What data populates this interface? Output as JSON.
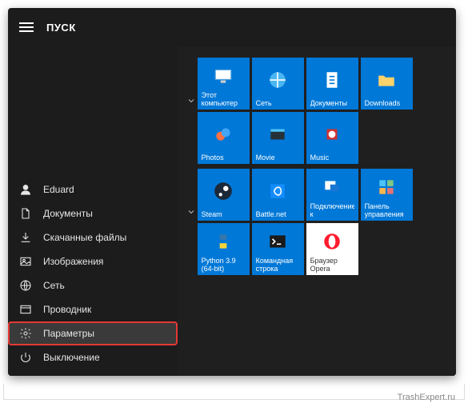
{
  "title": "ПУСК",
  "sidebar": [
    {
      "label": "Eduard",
      "icon": "user"
    },
    {
      "label": "Документы",
      "icon": "document"
    },
    {
      "label": "Скачанные файлы",
      "icon": "download"
    },
    {
      "label": "Изображения",
      "icon": "image"
    },
    {
      "label": "Сеть",
      "icon": "globe"
    },
    {
      "label": "Проводник",
      "icon": "explorer"
    },
    {
      "label": "Параметры",
      "icon": "gear",
      "highlight": true,
      "selected": true
    },
    {
      "label": "Выключение",
      "icon": "power"
    }
  ],
  "groups": [
    {
      "tiles": [
        {
          "label": "Этот компьютер",
          "icon": "pc"
        },
        {
          "label": "Сеть",
          "icon": "network"
        },
        {
          "label": "Документы",
          "icon": "docs"
        },
        {
          "label": "Downloads",
          "icon": "folder"
        },
        {
          "label": "Photos",
          "icon": "photos"
        },
        {
          "label": "Movie",
          "icon": "movie"
        },
        {
          "label": "Music",
          "icon": "music"
        }
      ]
    },
    {
      "tiles": [
        {
          "label": "Steam",
          "icon": "steam"
        },
        {
          "label": "Battle.net",
          "icon": "battlenet"
        },
        {
          "label": "Подключение к удаленном...",
          "icon": "rdp"
        },
        {
          "label": "Панель управления",
          "icon": "cpanel"
        },
        {
          "label": "Python 3.9 (64-bit)",
          "icon": "python"
        },
        {
          "label": "Командная строка",
          "icon": "cmd"
        },
        {
          "label": "Браузер Opera",
          "icon": "opera",
          "white": true
        }
      ]
    }
  ],
  "watermark": "TrashExpert.ru"
}
